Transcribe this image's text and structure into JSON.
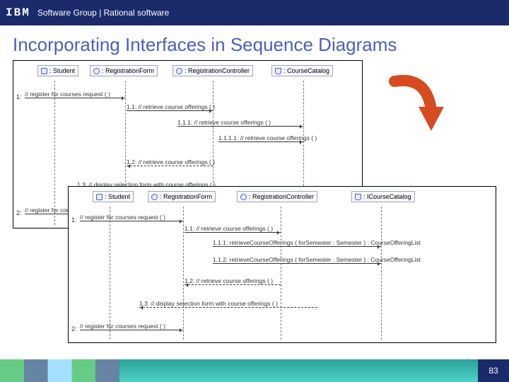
{
  "topbar": {
    "logo": "IBM",
    "subtitle": "Software Group | Rational software"
  },
  "slide": {
    "title": "Incorporating Interfaces in Sequence Diagrams",
    "pageNumber": "83"
  },
  "diagram1": {
    "participants": [
      {
        "name": ": Student"
      },
      {
        "name": ": RegistrationForm"
      },
      {
        "name": ": RegistrationController"
      },
      {
        "name": ": CourseCatalog"
      }
    ],
    "rowLabels": [
      "1:",
      "2:"
    ],
    "messages": [
      "// register for courses request ( )",
      "1.1: // retrieve course offerings ( )",
      "1.1.1: // retrieve course offerings ( )",
      "1.1.1.1: // retrieve course offerings ( )",
      "1.2: // retrieve course offerings ( )",
      "1.3: // display selection form with course offerings ( )",
      "// register for courses request ( )"
    ]
  },
  "diagram2": {
    "participants": [
      {
        "name": ": Student"
      },
      {
        "name": ": RegistrationForm"
      },
      {
        "name": ": RegistrationController"
      },
      {
        "name": ": ICourseCatalog"
      }
    ],
    "rowLabels": [
      "1:",
      "2:"
    ],
    "messages": [
      "// register for courses request ( )",
      "1.1: // retrieve course offerings ( )",
      "1.1.1: retrieveCourseOfferings ( forSemester : Semester ) : CourseOfferingList",
      "1.1.2: retrieveCourseOfferings ( forSemester : Semester ) : CourseOfferingList",
      "1.2: // retrieve course offerings ( )",
      "1.3: // display selection form with course offerings ( )",
      "// register for courses request ( )"
    ]
  }
}
